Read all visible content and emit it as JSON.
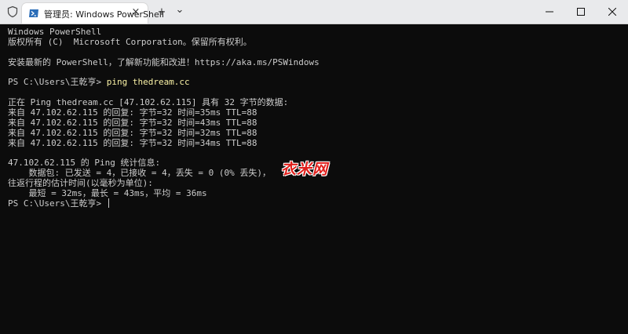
{
  "tab": {
    "title": "管理员: Windows PowerShell",
    "close": "×"
  },
  "toolbar": {
    "new_tab": "+",
    "dropdown": "⌄"
  },
  "terminal": {
    "lines": [
      "Windows PowerShell",
      "版权所有 (C)  Microsoft Corporation。保留所有权利。",
      "",
      "安装最新的 PowerShell，了解新功能和改进！https://aka.ms/PSWindows",
      "",
      "",
      "",
      "正在 Ping thedream.cc [47.102.62.115] 具有 32 字节的数据:",
      "来自 47.102.62.115 的回复: 字节=32 时间=35ms TTL=88",
      "来自 47.102.62.115 的回复: 字节=32 时间=43ms TTL=88",
      "来自 47.102.62.115 的回复: 字节=32 时间=32ms TTL=88",
      "来自 47.102.62.115 的回复: 字节=32 时间=34ms TTL=88",
      "",
      "47.102.62.115 的 Ping 统计信息:",
      "    数据包: 已发送 = 4，已接收 = 4，丢失 = 0 (0% 丢失)，",
      "往返行程的估计时间(以毫秒为单位):",
      "    最短 = 32ms，最长 = 43ms，平均 = 36ms"
    ],
    "prompt1": "PS C:\\Users\\王乾亨> ",
    "command": "ping thedream.cc",
    "prompt2": "PS C:\\Users\\王乾亨> "
  },
  "watermark": "衣米网"
}
